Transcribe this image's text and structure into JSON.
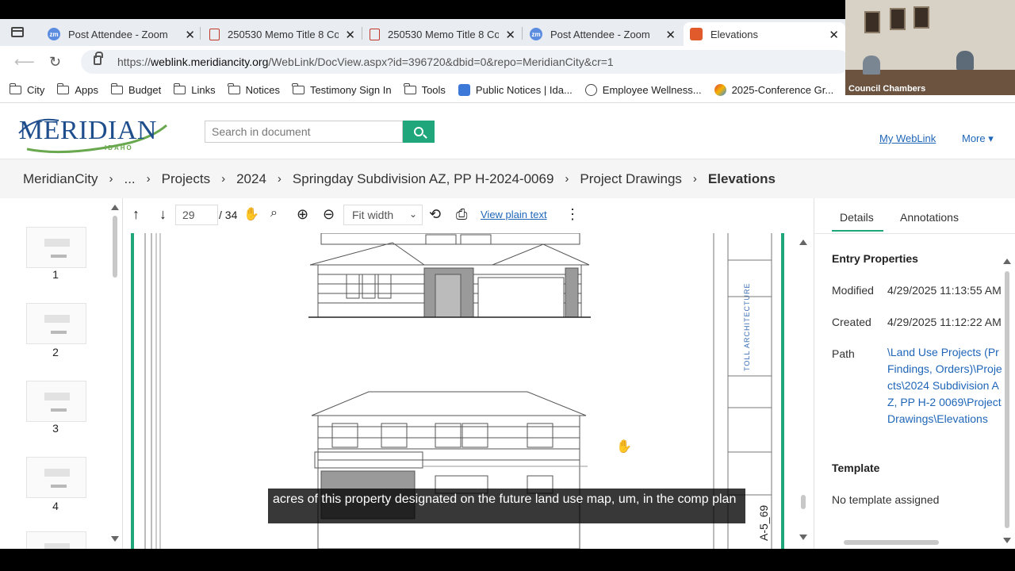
{
  "browser": {
    "tabs": [
      {
        "label": "Post Attendee - Zoom",
        "icon": "zoom-icon"
      },
      {
        "label": "250530 Memo Title 8 Cod",
        "icon": "pdf-icon"
      },
      {
        "label": "250530 Memo Title 8 Cod",
        "icon": "pdf-icon"
      },
      {
        "label": "Post Attendee - Zoom",
        "icon": "zoom-icon"
      },
      {
        "label": "Elevations",
        "icon": "weblink-icon",
        "active": true
      }
    ],
    "url_prefix": "https://",
    "url_domain": "weblink.meridiancity.org",
    "url_path": "/WebLink/DocView.aspx?id=396720&dbid=0&repo=MeridianCity&cr=1",
    "bookmarks": [
      {
        "label": "City",
        "icon": "briefcase-icon"
      },
      {
        "label": "Apps",
        "icon": "folder-icon"
      },
      {
        "label": "Budget",
        "icon": "folder-icon"
      },
      {
        "label": "Links",
        "icon": "folder-icon"
      },
      {
        "label": "Notices",
        "icon": "folder-icon"
      },
      {
        "label": "Testimony Sign In",
        "icon": "folder-icon"
      },
      {
        "label": "Tools",
        "icon": "folder-icon"
      },
      {
        "label": "Public Notices | Ida...",
        "icon": "notice-icon"
      },
      {
        "label": "Employee Wellness...",
        "icon": "globe-icon"
      },
      {
        "label": "2025-Conference Gr...",
        "icon": "conference-icon"
      }
    ]
  },
  "site": {
    "logo_text": "MERIDIAN",
    "logo_sub": "IDAHO",
    "search_placeholder": "Search in document",
    "my_weblink": "My WebLink",
    "more": "More ▾"
  },
  "breadcrumb": [
    "MeridianCity",
    "...",
    "Projects",
    "2024",
    "Springday Subdivision AZ, PP H-2024-0069",
    "Project Drawings",
    "Elevations"
  ],
  "thumbnails": [
    "1",
    "2",
    "3",
    "4"
  ],
  "toolbar": {
    "page": "29",
    "total": "/ 34",
    "fit": "Fit width",
    "view_plain_text": "View plain text"
  },
  "drawing": {
    "firm": "TOLL ARCHITECTURE",
    "sheet": "A-5_69"
  },
  "caption": "acres of this property designated on the future land use map, um, in the comp plan",
  "details": {
    "tabs": [
      "Details",
      "Annotations"
    ],
    "entry_properties": "Entry Properties",
    "modified_label": "Modified",
    "modified_value": "4/29/2025 11:13:55 AM",
    "created_label": "Created",
    "created_value": "4/29/2025 11:12:22 AM",
    "path_label": "Path",
    "path_value": "\\Land Use Projects (Pr Findings, Orders)\\Projects\\2024 Subdivision AZ, PP H-2 0069\\Project Drawings\\Elevations",
    "template_heading": "Template",
    "template_value": "No template assigned"
  },
  "webcam": {
    "label": "Council Chambers"
  },
  "colors": {
    "accent": "#1fa67a",
    "link": "#1f66b8"
  }
}
